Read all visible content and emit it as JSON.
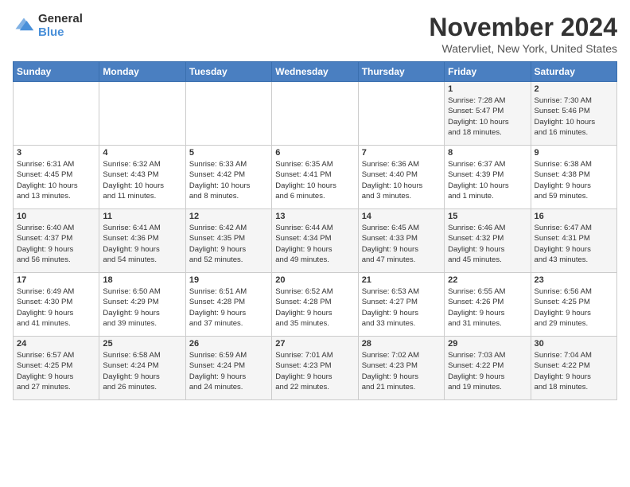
{
  "logo": {
    "general": "General",
    "blue": "Blue"
  },
  "title": "November 2024",
  "subtitle": "Watervliet, New York, United States",
  "headers": [
    "Sunday",
    "Monday",
    "Tuesday",
    "Wednesday",
    "Thursday",
    "Friday",
    "Saturday"
  ],
  "weeks": [
    [
      {
        "day": "",
        "info": ""
      },
      {
        "day": "",
        "info": ""
      },
      {
        "day": "",
        "info": ""
      },
      {
        "day": "",
        "info": ""
      },
      {
        "day": "",
        "info": ""
      },
      {
        "day": "1",
        "info": "Sunrise: 7:28 AM\nSunset: 5:47 PM\nDaylight: 10 hours\nand 18 minutes."
      },
      {
        "day": "2",
        "info": "Sunrise: 7:30 AM\nSunset: 5:46 PM\nDaylight: 10 hours\nand 16 minutes."
      }
    ],
    [
      {
        "day": "3",
        "info": "Sunrise: 6:31 AM\nSunset: 4:45 PM\nDaylight: 10 hours\nand 13 minutes."
      },
      {
        "day": "4",
        "info": "Sunrise: 6:32 AM\nSunset: 4:43 PM\nDaylight: 10 hours\nand 11 minutes."
      },
      {
        "day": "5",
        "info": "Sunrise: 6:33 AM\nSunset: 4:42 PM\nDaylight: 10 hours\nand 8 minutes."
      },
      {
        "day": "6",
        "info": "Sunrise: 6:35 AM\nSunset: 4:41 PM\nDaylight: 10 hours\nand 6 minutes."
      },
      {
        "day": "7",
        "info": "Sunrise: 6:36 AM\nSunset: 4:40 PM\nDaylight: 10 hours\nand 3 minutes."
      },
      {
        "day": "8",
        "info": "Sunrise: 6:37 AM\nSunset: 4:39 PM\nDaylight: 10 hours\nand 1 minute."
      },
      {
        "day": "9",
        "info": "Sunrise: 6:38 AM\nSunset: 4:38 PM\nDaylight: 9 hours\nand 59 minutes."
      }
    ],
    [
      {
        "day": "10",
        "info": "Sunrise: 6:40 AM\nSunset: 4:37 PM\nDaylight: 9 hours\nand 56 minutes."
      },
      {
        "day": "11",
        "info": "Sunrise: 6:41 AM\nSunset: 4:36 PM\nDaylight: 9 hours\nand 54 minutes."
      },
      {
        "day": "12",
        "info": "Sunrise: 6:42 AM\nSunset: 4:35 PM\nDaylight: 9 hours\nand 52 minutes."
      },
      {
        "day": "13",
        "info": "Sunrise: 6:44 AM\nSunset: 4:34 PM\nDaylight: 9 hours\nand 49 minutes."
      },
      {
        "day": "14",
        "info": "Sunrise: 6:45 AM\nSunset: 4:33 PM\nDaylight: 9 hours\nand 47 minutes."
      },
      {
        "day": "15",
        "info": "Sunrise: 6:46 AM\nSunset: 4:32 PM\nDaylight: 9 hours\nand 45 minutes."
      },
      {
        "day": "16",
        "info": "Sunrise: 6:47 AM\nSunset: 4:31 PM\nDaylight: 9 hours\nand 43 minutes."
      }
    ],
    [
      {
        "day": "17",
        "info": "Sunrise: 6:49 AM\nSunset: 4:30 PM\nDaylight: 9 hours\nand 41 minutes."
      },
      {
        "day": "18",
        "info": "Sunrise: 6:50 AM\nSunset: 4:29 PM\nDaylight: 9 hours\nand 39 minutes."
      },
      {
        "day": "19",
        "info": "Sunrise: 6:51 AM\nSunset: 4:28 PM\nDaylight: 9 hours\nand 37 minutes."
      },
      {
        "day": "20",
        "info": "Sunrise: 6:52 AM\nSunset: 4:28 PM\nDaylight: 9 hours\nand 35 minutes."
      },
      {
        "day": "21",
        "info": "Sunrise: 6:53 AM\nSunset: 4:27 PM\nDaylight: 9 hours\nand 33 minutes."
      },
      {
        "day": "22",
        "info": "Sunrise: 6:55 AM\nSunset: 4:26 PM\nDaylight: 9 hours\nand 31 minutes."
      },
      {
        "day": "23",
        "info": "Sunrise: 6:56 AM\nSunset: 4:25 PM\nDaylight: 9 hours\nand 29 minutes."
      }
    ],
    [
      {
        "day": "24",
        "info": "Sunrise: 6:57 AM\nSunset: 4:25 PM\nDaylight: 9 hours\nand 27 minutes."
      },
      {
        "day": "25",
        "info": "Sunrise: 6:58 AM\nSunset: 4:24 PM\nDaylight: 9 hours\nand 26 minutes."
      },
      {
        "day": "26",
        "info": "Sunrise: 6:59 AM\nSunset: 4:24 PM\nDaylight: 9 hours\nand 24 minutes."
      },
      {
        "day": "27",
        "info": "Sunrise: 7:01 AM\nSunset: 4:23 PM\nDaylight: 9 hours\nand 22 minutes."
      },
      {
        "day": "28",
        "info": "Sunrise: 7:02 AM\nSunset: 4:23 PM\nDaylight: 9 hours\nand 21 minutes."
      },
      {
        "day": "29",
        "info": "Sunrise: 7:03 AM\nSunset: 4:22 PM\nDaylight: 9 hours\nand 19 minutes."
      },
      {
        "day": "30",
        "info": "Sunrise: 7:04 AM\nSunset: 4:22 PM\nDaylight: 9 hours\nand 18 minutes."
      }
    ]
  ]
}
